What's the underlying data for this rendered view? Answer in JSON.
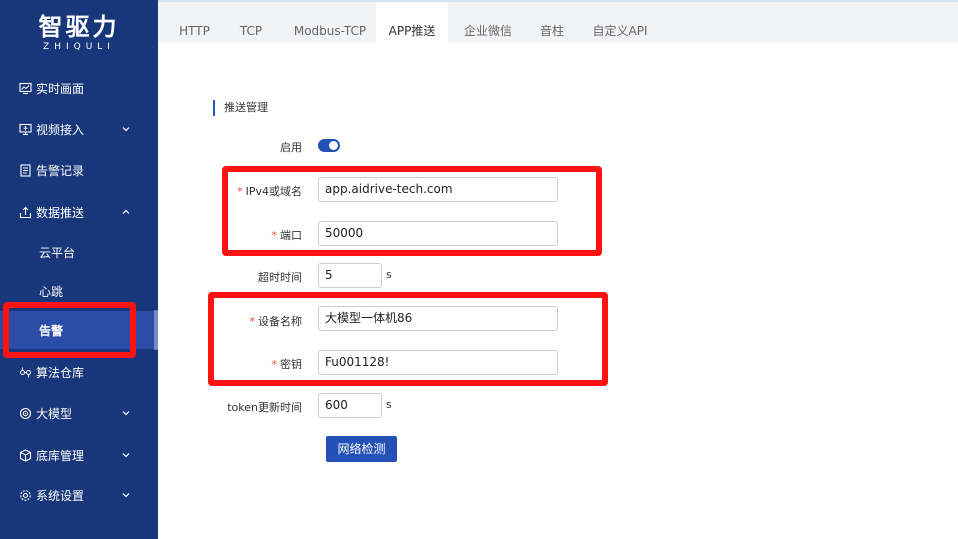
{
  "brand": {
    "name": "智驱力",
    "subtitle": "ZHIQULI"
  },
  "sidebar": {
    "items": [
      {
        "label": "实时画面",
        "icon": "monitor-chart-icon"
      },
      {
        "label": "视频接入",
        "icon": "video-input-icon",
        "expanded": false
      },
      {
        "label": "告警记录",
        "icon": "document-icon"
      },
      {
        "label": "数据推送",
        "icon": "upload-icon",
        "expanded": true
      },
      {
        "label": "算法仓库",
        "icon": "algorithm-icon"
      },
      {
        "label": "大模型",
        "icon": "model-icon",
        "expanded": false
      },
      {
        "label": "底库管理",
        "icon": "cube-icon",
        "expanded": false
      },
      {
        "label": "系统设置",
        "icon": "gear-icon",
        "expanded": false
      }
    ],
    "subitems": [
      {
        "label": "云平台"
      },
      {
        "label": "心跳"
      },
      {
        "label": "告警",
        "active": true
      }
    ]
  },
  "tabs": [
    {
      "label": "HTTP"
    },
    {
      "label": "TCP"
    },
    {
      "label": "Modbus-TCP"
    },
    {
      "label": "APP推送",
      "active": true
    },
    {
      "label": "企业微信"
    },
    {
      "label": "音柱"
    },
    {
      "label": "自定义API"
    }
  ],
  "section": {
    "title": "推送管理"
  },
  "form": {
    "enable": {
      "label": "启用",
      "value": true
    },
    "host": {
      "label": "IPv4或域名",
      "required": true,
      "value": "app.aidrive-tech.com"
    },
    "port": {
      "label": "端口",
      "required": true,
      "value": "50000"
    },
    "timeout": {
      "label": "超时时间",
      "value": "5",
      "unit": "s"
    },
    "device_name": {
      "label": "设备名称",
      "required": true,
      "value": "大模型一体机86"
    },
    "secret": {
      "label": "密钥",
      "required": true,
      "value": "Fu001128!"
    },
    "token_refresh": {
      "label": "token更新时间",
      "value": "600",
      "unit": "s"
    },
    "network_test_button": "网络检测"
  },
  "required_mark": "*",
  "colors": {
    "sidebar_bg": "#18377a",
    "accent": "#2451b5",
    "highlight": "#ff1212"
  }
}
